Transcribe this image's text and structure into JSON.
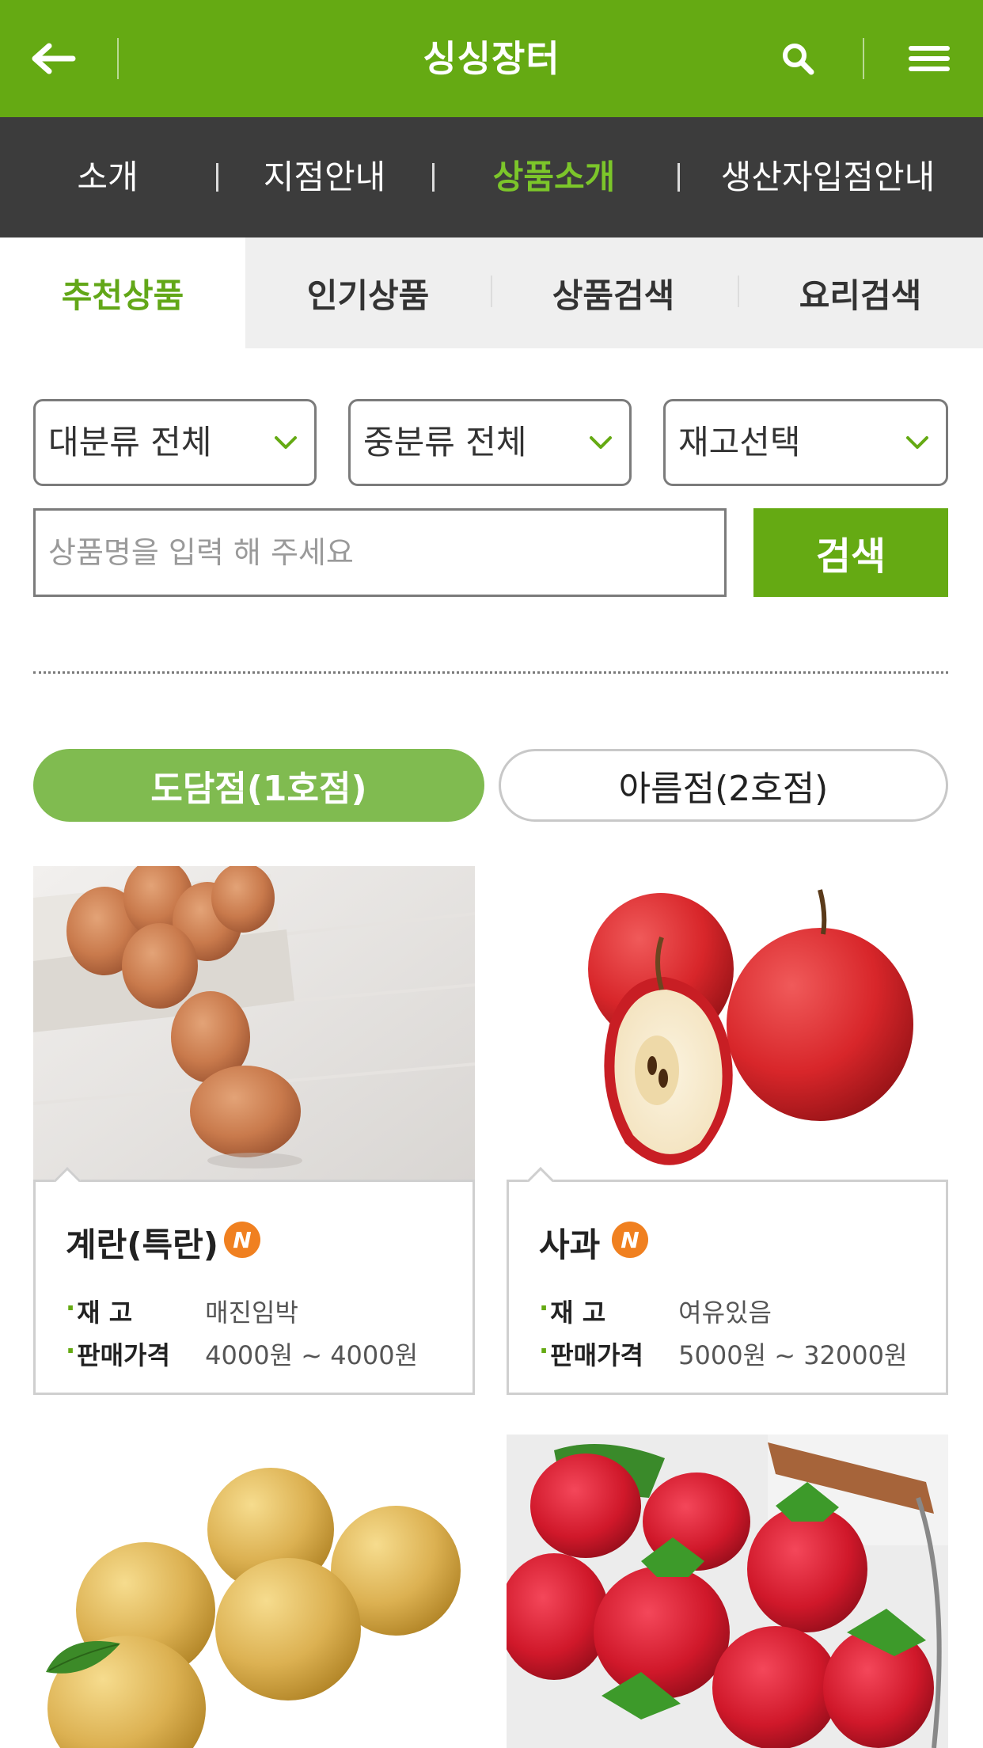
{
  "header": {
    "title": "싱싱장터"
  },
  "gnb": [
    {
      "label": "소개",
      "active": false
    },
    {
      "label": "지점안내",
      "active": false
    },
    {
      "label": "상품소개",
      "active": true
    },
    {
      "label": "생산자입점안내",
      "active": false
    }
  ],
  "tabs": [
    {
      "label": "추천상품",
      "active": true
    },
    {
      "label": "인기상품",
      "active": false
    },
    {
      "label": "상품검색",
      "active": false
    },
    {
      "label": "요리검색",
      "active": false
    }
  ],
  "filters": {
    "category_major": "대분류 전체",
    "category_minor": "중분류 전체",
    "stock": "재고선택"
  },
  "search": {
    "placeholder": "상품명을 입력 해 주세요",
    "button": "검색"
  },
  "stores": [
    {
      "label": "도담점(1호점)",
      "active": true
    },
    {
      "label": "아름점(2호점)",
      "active": false
    }
  ],
  "labels": {
    "stock": "재 고",
    "price": "판매가격",
    "new_badge": "N"
  },
  "products": [
    {
      "name": "계란(특란)",
      "is_new": true,
      "stock": "매진임박",
      "price": "4000원 ~ 4000원",
      "image": "eggs"
    },
    {
      "name": "사과",
      "is_new": true,
      "stock": "여유있음",
      "price": "5000원 ~ 32000원",
      "image": "apples"
    },
    {
      "image": "pears"
    },
    {
      "image": "strawberries"
    }
  ],
  "colors": {
    "primary": "#65aa13",
    "nav_dark": "#3c3c3c",
    "active_text": "#7cc62a",
    "badge": "#f08020",
    "store_active": "#80bb50"
  }
}
